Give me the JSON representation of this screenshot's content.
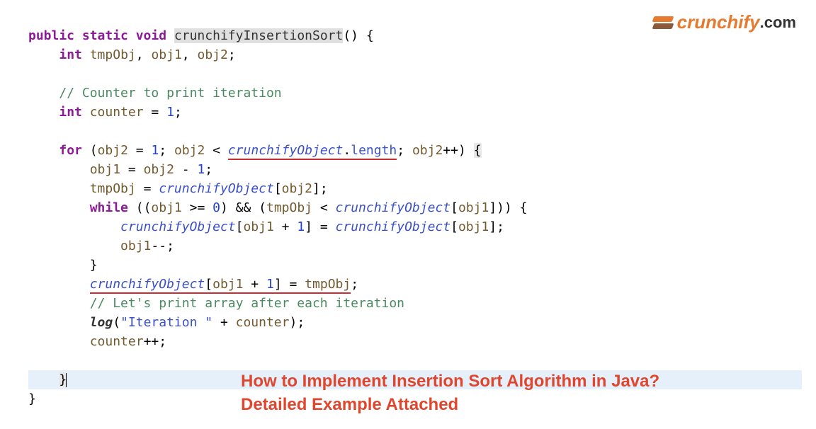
{
  "logo": {
    "brand": "crunchify",
    "tld": ".com"
  },
  "headline": {
    "line1": "How to Implement Insertion Sort Algorithm in Java?",
    "line2": "Detailed Example Attached"
  },
  "code": {
    "l1": {
      "mods": "public static void",
      "mname": "crunchifyInsertionSort",
      "after": "() {"
    },
    "l2": {
      "type": "int",
      "v1": "tmpObj",
      "v2": "obj1",
      "v3": "obj2"
    },
    "l4": {
      "comment": "// Counter to print iteration"
    },
    "l5": {
      "type": "int",
      "var": "counter",
      "val": "1"
    },
    "l7": {
      "kw": "for",
      "o2": "obj2",
      "one": "1",
      "o2b": "obj2",
      "field": "crunchifyObject",
      "len": "length",
      "o2c": "obj2",
      "brace": "{"
    },
    "l8": {
      "v1": "obj1",
      "v2": "obj2",
      "one": "1"
    },
    "l9": {
      "t": "tmpObj",
      "field": "crunchifyObject",
      "v": "obj2"
    },
    "l10": {
      "kw": "while",
      "v1": "obj1",
      "zero": "0",
      "t": "tmpObj",
      "field": "crunchifyObject",
      "v1b": "obj1"
    },
    "l11": {
      "field": "crunchifyObject",
      "v1": "obj1",
      "one": "1",
      "field2": "crunchifyObject",
      "v1b": "obj1"
    },
    "l12": {
      "v": "obj1"
    },
    "l14": {
      "field": "crunchifyObject",
      "v": "obj1",
      "one": "1",
      "t": "tmpObj"
    },
    "l15": {
      "comment": "// Let's print array after each iteration"
    },
    "l16": {
      "fn": "log",
      "str": "\"Iteration \"",
      "v": "counter"
    },
    "l17": {
      "v": "counter"
    }
  }
}
